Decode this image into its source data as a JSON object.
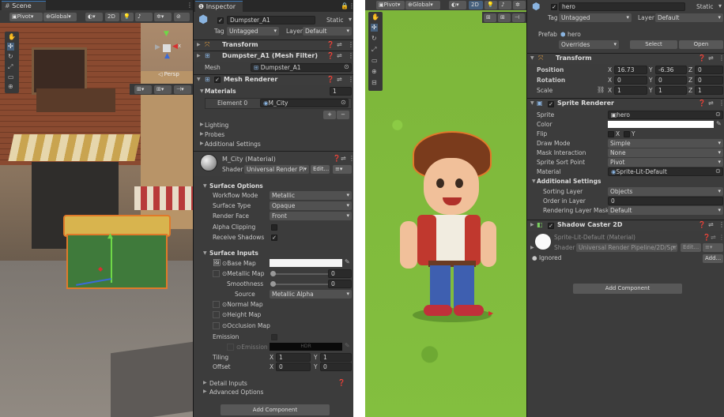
{
  "left_scene": {
    "tab": "Scene",
    "tools": {
      "pivot": "Pivot",
      "global": "Global",
      "mode_2d": "2D",
      "persp": "◁ Persp"
    },
    "axis_x": "x"
  },
  "inspector": {
    "tab": "Inspector",
    "object_name": "Dumpster_A1",
    "static_label": "Static",
    "tag_label": "Tag",
    "tag_value": "Untagged",
    "layer_label": "Layer",
    "layer_value": "Default",
    "transform": "Transform",
    "mesh_filter": "Dumpster_A1 (Mesh Filter)",
    "mesh_label": "Mesh",
    "mesh_value": "Dumpster_A1",
    "mesh_renderer": "Mesh Renderer",
    "materials_label": "Materials",
    "materials_count": "1",
    "element_label": "Element 0",
    "element_value": "M_City",
    "lighting": "Lighting",
    "probes": "Probes",
    "additional_settings": "Additional Settings",
    "material_name": "M_City (Material)",
    "shader_label": "Shader",
    "shader_value": "Universal Render Pi",
    "edit": "Edit...",
    "surface_options": "Surface Options",
    "workflow_label": "Workflow Mode",
    "workflow_value": "Metallic",
    "surface_type_label": "Surface Type",
    "surface_type_value": "Opaque",
    "render_face_label": "Render Face",
    "render_face_value": "Front",
    "alpha_clip_label": "Alpha Clipping",
    "receive_shadows_label": "Receive Shadows",
    "receive_shadows_check": "✓",
    "surface_inputs": "Surface Inputs",
    "base_map": "Base Map",
    "metallic_map": "Metallic Map",
    "metallic_value": "0",
    "smoothness": "Smoothness",
    "smoothness_value": "0",
    "source_label": "Source",
    "source_value": "Metallic Alpha",
    "normal_map": "Normal Map",
    "height_map": "Height Map",
    "occlusion_map": "Occlusion Map",
    "emission": "Emission",
    "emission_map": "Emission M",
    "hdr": "HDR",
    "tiling": "Tiling",
    "offset": "Offset",
    "tiling_x": "1",
    "tiling_y": "1",
    "offset_x": "0",
    "offset_y": "0",
    "x": "X",
    "y": "Y",
    "detail_inputs": "Detail Inputs",
    "advanced_options": "Advanced Options",
    "add_component": "Add Component"
  },
  "right_scene": {
    "tools": {
      "pivot": "Pivot",
      "global": "Global",
      "mode_2d": "2D"
    }
  },
  "hero_inspector": {
    "name": "hero",
    "static_label": "Static",
    "tag_label": "Tag",
    "tag_value": "Untagged",
    "layer_label": "Layer",
    "layer_value": "Default",
    "prefab_label": "Prefab",
    "prefab_value": "hero",
    "overrides": "Overrides",
    "select": "Select",
    "open": "Open",
    "transform": "Transform",
    "position_label": "Position",
    "rotation_label": "Rotation",
    "scale_label": "Scale",
    "x": "X",
    "y": "Y",
    "z": "Z",
    "pos_x": "16.73",
    "pos_y": "-6.36",
    "pos_z": "0",
    "rot_x": "0",
    "rot_y": "0",
    "rot_z": "0",
    "scale_x": "1",
    "scale_y": "1",
    "scale_z": "1",
    "sprite_renderer": "Sprite Renderer",
    "sprite_label": "Sprite",
    "sprite_value": "hero",
    "color_label": "Color",
    "flip_label": "Flip",
    "flip_x": "X",
    "flip_y": "Y",
    "draw_mode_label": "Draw Mode",
    "draw_mode_value": "Simple",
    "mask_label": "Mask Interaction",
    "mask_value": "None",
    "sort_point_label": "Sprite Sort Point",
    "sort_point_value": "Pivot",
    "material_label": "Material",
    "material_value": "Sprite-Lit-Default",
    "additional_settings": "Additional Settings",
    "sorting_layer_label": "Sorting Layer",
    "sorting_layer_value": "Objects",
    "order_label": "Order in Layer",
    "order_value": "0",
    "rendering_layer_label": "Rendering Layer Mask",
    "rendering_layer_value": "Default",
    "shadow_caster": "Shadow Caster 2D",
    "material_name": "Sprite-Lit-Default (Material)",
    "shader_label": "Shader",
    "shader_value": "Universal Render Pipeline/2D/Spri",
    "edit": "Edit...",
    "ignored": "Ignored",
    "add": "Add...",
    "add_component": "Add Component"
  }
}
